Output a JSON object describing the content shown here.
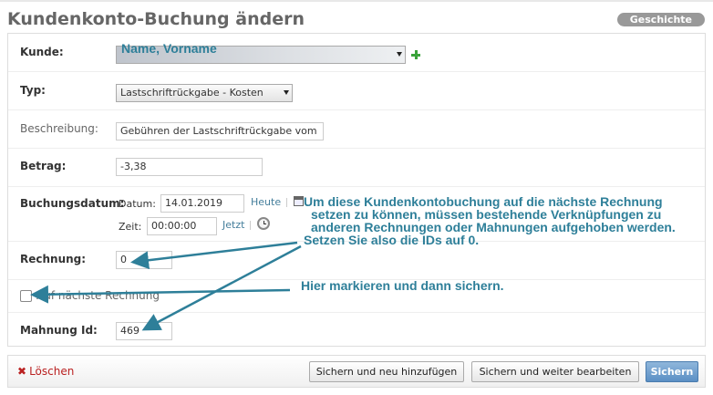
{
  "header": {
    "title": "Kundenkonto-Buchung ändern",
    "history_button": "Geschichte"
  },
  "form": {
    "kunde": {
      "label": "Kunde:",
      "value": "Name, Vorname"
    },
    "typ": {
      "label": "Typ:",
      "value": "Lastschriftrückgabe - Kosten"
    },
    "beschreibung": {
      "label": "Beschreibung:",
      "value": "Gebühren der Lastschriftrückgabe vom"
    },
    "betrag": {
      "label": "Betrag:",
      "value": "-3,38"
    },
    "buchungsdatum": {
      "label": "Buchungsdatum:",
      "date_label": "Datum:",
      "date_value": "14.01.2019",
      "today_link": "Heute",
      "time_label": "Zeit:",
      "time_value": "00:00:00",
      "now_link": "Jetzt"
    },
    "rechnung": {
      "label": "Rechnung:",
      "value": "0"
    },
    "auf_naechste": {
      "label": "Auf nächste Rechnung",
      "checked": false
    },
    "mahnung": {
      "label": "Mahnung Id:",
      "value": "469"
    }
  },
  "annotations": {
    "note1_line1": "Um diese Kundenkontobuchung auf die nächste Rechnung",
    "note1_line2": "setzen zu können, müssen bestehende Verknüpfungen zu",
    "note1_line3": "anderen Rechnungen oder Mahnungen aufgehoben werden.",
    "note1_line4": "Setzen Sie also die IDs auf 0.",
    "note2": "Hier markieren und dann sichern.",
    "color": "#2e7f99"
  },
  "footer": {
    "delete_label": "Löschen",
    "save_add_label": "Sichern und neu hinzufügen",
    "save_continue_label": "Sichern und weiter bearbeiten",
    "save_label": "Sichern"
  },
  "icons": {
    "add": "plus-icon",
    "calendar": "calendar-icon",
    "clock": "clock-icon",
    "delete": "x-icon"
  }
}
